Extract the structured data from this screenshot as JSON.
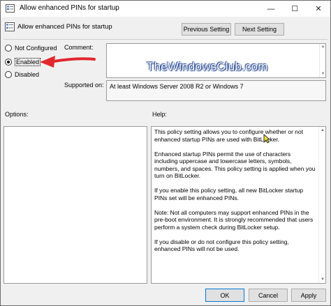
{
  "window": {
    "title": "Allow enhanced PINs for startup",
    "controls": {
      "minimize": "—",
      "maximize": "☐",
      "close": "✕"
    }
  },
  "header": {
    "title": "Allow enhanced PINs for startup",
    "prev_label": "Previous Setting",
    "next_label": "Next Setting"
  },
  "state": {
    "options": [
      {
        "label": "Not Configured",
        "checked": false
      },
      {
        "label": "Enabled",
        "checked": true
      },
      {
        "label": "Disabled",
        "checked": false
      }
    ]
  },
  "comment": {
    "label": "Comment:",
    "value": ""
  },
  "supported": {
    "label": "Supported on:",
    "value": "At least Windows Server 2008 R2 or Windows 7"
  },
  "panels": {
    "options_label": "Options:",
    "help_label": "Help:"
  },
  "help": {
    "paragraphs": [
      "This policy setting allows you to configure whether or not enhanced startup PINs are used with BitLocker.",
      "Enhanced startup PINs permit the use of characters including uppercase and lowercase letters, symbols, numbers, and spaces. This policy setting is applied when you turn on BitLocker.",
      "If you enable this policy setting, all new BitLocker startup PINs set will be enhanced PINs.",
      "Note:   Not all computers may support enhanced PINs in the pre-boot environment. It is strongly recommended that users perform a system check during BitLocker setup.",
      "If you disable or do not configure this policy setting, enhanced PINs will not be used."
    ]
  },
  "footer": {
    "ok_label": "OK",
    "cancel_label": "Cancel",
    "apply_label": "Apply"
  },
  "watermark": "TheWindowsClub.com",
  "colors": {
    "accent": "#0078d7",
    "arrow": "#e0282d",
    "watermark_outline": "#1b3e8a"
  }
}
